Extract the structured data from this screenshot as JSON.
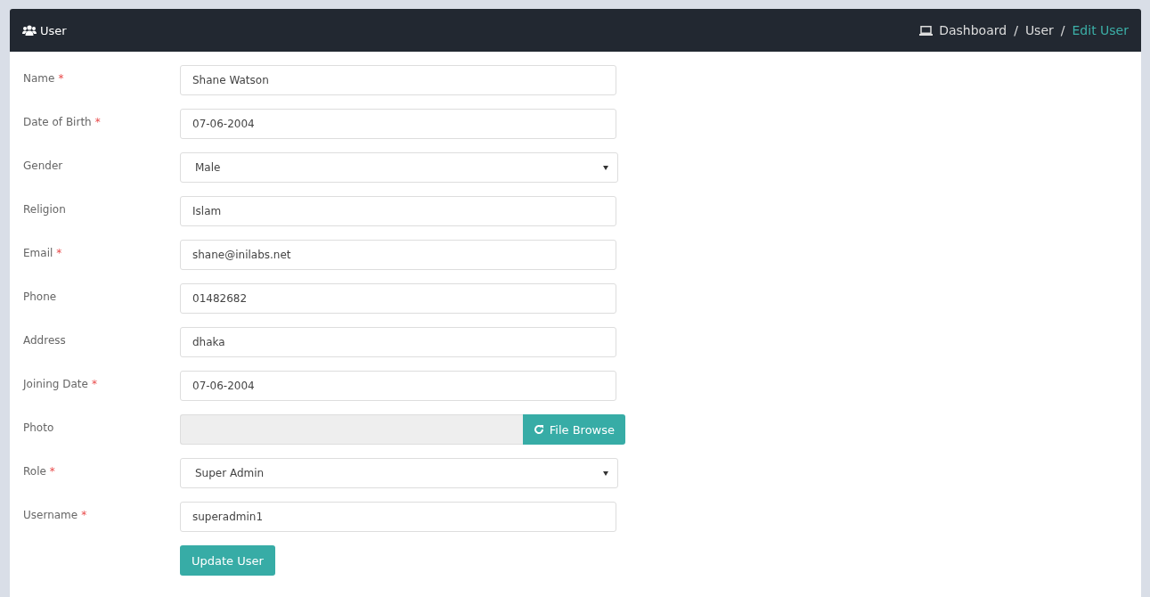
{
  "header": {
    "title": "User",
    "breadcrumb": [
      {
        "label": "Dashboard",
        "selected": false
      },
      {
        "label": "User",
        "selected": false
      },
      {
        "label": "Edit User",
        "selected": true
      }
    ],
    "separator": "/"
  },
  "required_mark": "*",
  "fields": [
    {
      "label": "Name",
      "required": true,
      "kind": "text",
      "value": "Shane Watson"
    },
    {
      "label": "Date of Birth",
      "required": true,
      "kind": "text",
      "value": "07-06-2004"
    },
    {
      "label": "Gender",
      "required": false,
      "kind": "select",
      "value": "Male"
    },
    {
      "label": "Religion",
      "required": false,
      "kind": "text",
      "value": "Islam"
    },
    {
      "label": "Email",
      "required": true,
      "kind": "text",
      "value": "shane@inilabs.net"
    },
    {
      "label": "Phone",
      "required": false,
      "kind": "text",
      "value": "01482682"
    },
    {
      "label": "Address",
      "required": false,
      "kind": "text",
      "value": "dhaka"
    },
    {
      "label": "Joining Date",
      "required": true,
      "kind": "text",
      "value": "07-06-2004"
    },
    {
      "label": "Photo",
      "required": false,
      "kind": "file",
      "button": "File Browse"
    },
    {
      "label": "Role",
      "required": true,
      "kind": "select",
      "value": "Super Admin"
    },
    {
      "label": "Username",
      "required": true,
      "kind": "text",
      "value": "superadmin1"
    }
  ],
  "submit": "Update User"
}
